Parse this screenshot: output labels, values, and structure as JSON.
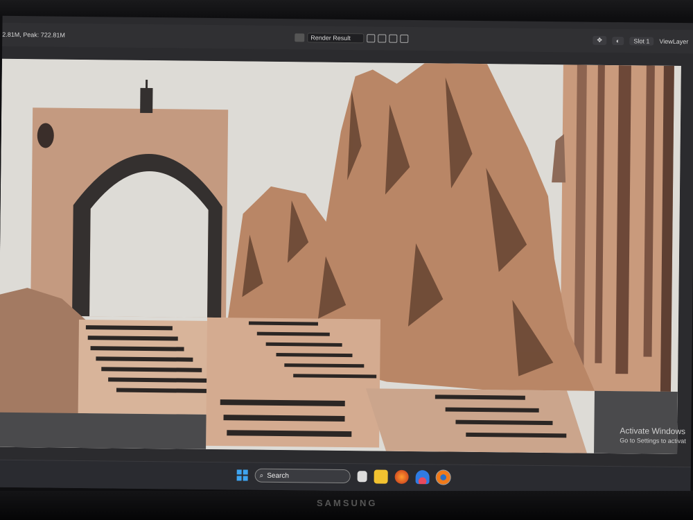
{
  "header": {
    "memory_text": "2.81M, Peak: 722.81M",
    "image_name": "Render Result",
    "slot": "Slot 1",
    "view_layer": "ViewLayer"
  },
  "watermark": {
    "title": "Activate Windows",
    "subtitle": "Go to Settings to activat"
  },
  "taskbar": {
    "search_label": "Search",
    "icons": [
      "windows-logo",
      "file-explorer-icon",
      "folder-icon",
      "firefox-icon",
      "app-arc-icon",
      "blender-icon"
    ]
  },
  "monitor": {
    "brand": "SAMSUNG"
  },
  "colors": {
    "sky": "#dddbd6",
    "rock": "#b98666",
    "rock_shadow": "#5a3a2a",
    "stone": "#d8b49a",
    "accent": "#3ea4f0"
  }
}
